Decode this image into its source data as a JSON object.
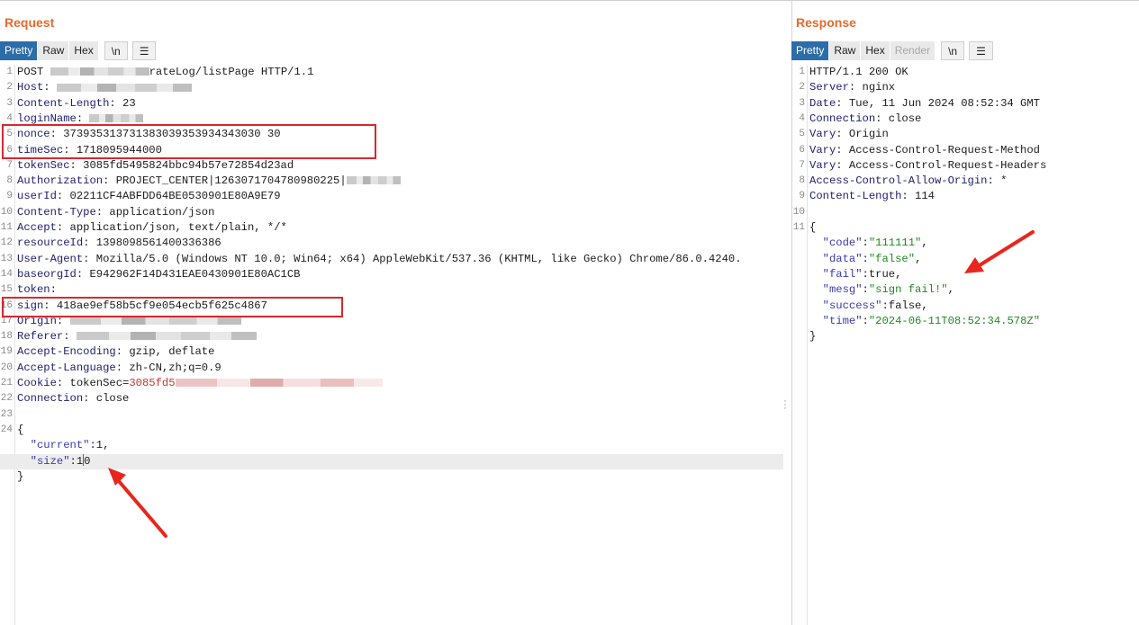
{
  "request": {
    "title": "Request",
    "tabs": [
      "Pretty",
      "Raw",
      "Hex"
    ],
    "newline_btn": "\\n",
    "menu_icon": "hamburger-menu-icon",
    "lines": [
      {
        "n": "1",
        "t": "POST ",
        "blur": 110,
        "t2": "rateLog/listPage HTTP/1.1"
      },
      {
        "n": "2",
        "t": "Host: ",
        "blur": 150
      },
      {
        "n": "3",
        "t": "Content-Length: 23"
      },
      {
        "n": "4",
        "t": "loginName: ",
        "blur": 60
      },
      {
        "n": "5",
        "t": "nonce: 373935313731383039353934343030 30"
      },
      {
        "n": "6",
        "t": "timeSec: 1718095944000"
      },
      {
        "n": "7",
        "t": "tokenSec: 3085fd5495824bbc94b57e72854d23ad"
      },
      {
        "n": "8",
        "t": "Authorization: PROJECT_CENTER|1263071704780980225|",
        "blur": 60
      },
      {
        "n": "9",
        "t": "userId: 02211CF4ABFDD64BE0530901E80A9E79"
      },
      {
        "n": "10",
        "t": "Content-Type: application/json"
      },
      {
        "n": "11",
        "t": "Accept: application/json, text/plain, */*"
      },
      {
        "n": "12",
        "t": "resourceId: 1398098561400336386"
      },
      {
        "n": "13",
        "t": "User-Agent: Mozilla/5.0 (Windows NT 10.0; Win64; x64) AppleWebKit/537.36 (KHTML, like Gecko) Chrome/86.0.4240."
      },
      {
        "n": "14",
        "t": "baseorgId: E942962F14D431EAE0430901E80AC1CB"
      },
      {
        "n": "15",
        "t": "token: "
      },
      {
        "n": "16",
        "t": "sign: 418ae9ef58b5cf9e054ecb5f625c4867"
      },
      {
        "n": "17",
        "t": "Origin: ",
        "blur": 190
      },
      {
        "n": "18",
        "t": "Referer: ",
        "blur": 200
      },
      {
        "n": "19",
        "t": "Accept-Encoding: gzip, deflate"
      },
      {
        "n": "20",
        "t": "Accept-Language: zh-CN,zh;q=0.9"
      },
      {
        "n": "21",
        "t": "Cookie: tokenSec=",
        "red": "3085fd5",
        "blurpink": 230
      },
      {
        "n": "22",
        "t": "Connection: close"
      },
      {
        "n": "23",
        "t": ""
      },
      {
        "n": "24",
        "t": "{"
      },
      {
        "n": "",
        "t": "  \"current\":1,"
      },
      {
        "n": "",
        "t": "  \"size\":10"
      },
      {
        "n": "",
        "t": "}"
      }
    ]
  },
  "response": {
    "title": "Response",
    "tabs": [
      "Pretty",
      "Raw",
      "Hex",
      "Render"
    ],
    "newline_btn": "\\n",
    "menu_icon": "hamburger-menu-icon",
    "lines": [
      {
        "n": "1",
        "t": "HTTP/1.1 200 OK"
      },
      {
        "n": "2",
        "t": "Server: nginx"
      },
      {
        "n": "3",
        "t": "Date: Tue, 11 Jun 2024 08:52:34 GMT"
      },
      {
        "n": "4",
        "t": "Connection: close"
      },
      {
        "n": "5",
        "t": "Vary: Origin"
      },
      {
        "n": "6",
        "t": "Vary: Access-Control-Request-Method"
      },
      {
        "n": "7",
        "t": "Vary: Access-Control-Request-Headers"
      },
      {
        "n": "8",
        "t": "Access-Control-Allow-Origin: *"
      },
      {
        "n": "9",
        "t": "Content-Length: 114"
      },
      {
        "n": "10",
        "t": ""
      },
      {
        "n": "11",
        "t": "{"
      },
      {
        "n": "",
        "t": "  \"code\":\"111111\","
      },
      {
        "n": "",
        "t": "  \"data\":\"false\","
      },
      {
        "n": "",
        "t": "  \"fail\":true,"
      },
      {
        "n": "",
        "t": "  \"mesg\":\"sign fail!\","
      },
      {
        "n": "",
        "t": "  \"success\":false,"
      },
      {
        "n": "",
        "t": "  \"time\":\"2024-06-11T08:52:34.578Z\""
      },
      {
        "n": "",
        "t": "}"
      }
    ]
  },
  "colors": {
    "accent": "#e8692a",
    "active_tab": "#2c6ca8",
    "highlight_box": "#d9272e",
    "arrow": "#e8261e"
  }
}
